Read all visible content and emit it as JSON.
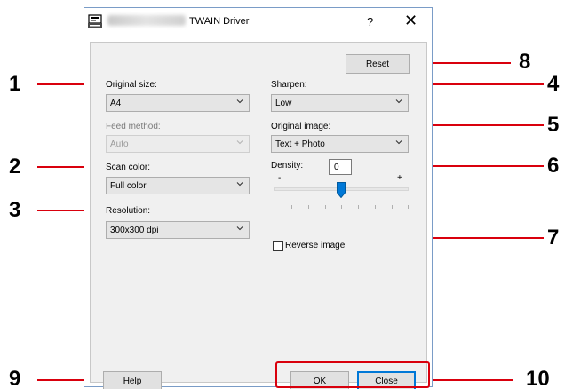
{
  "window": {
    "title": "TWAIN Driver",
    "help_glyph": "?",
    "close_glyph": "✕"
  },
  "left": {
    "original_size_label": "Original size:",
    "original_size_value": "A4",
    "feed_method_label": "Feed method:",
    "feed_method_value": "Auto",
    "scan_color_label": "Scan color:",
    "scan_color_value": "Full color",
    "resolution_label": "Resolution:",
    "resolution_value": "300x300 dpi"
  },
  "right": {
    "reset_label": "Reset",
    "sharpen_label": "Sharpen:",
    "sharpen_value": "Low",
    "original_image_label": "Original image:",
    "original_image_value": "Text + Photo",
    "density_label": "Density:",
    "density_value": "0",
    "density_minus": "-",
    "density_plus": "+",
    "density_level_fraction": 0.5,
    "reverse_image_label": "Reverse image",
    "reverse_image_checked": false
  },
  "footer": {
    "help_label": "Help",
    "ok_label": "OK",
    "close_label": "Close"
  },
  "callouts": {
    "c1": "1",
    "c2": "2",
    "c3": "3",
    "c4": "4",
    "c5": "5",
    "c6": "6",
    "c7": "7",
    "c8": "8",
    "c9": "9",
    "c10": "10"
  },
  "icons": {
    "app": "scanner-app-icon",
    "dropdown": "chevron-down-icon"
  },
  "colors": {
    "callout_red": "#d9000d",
    "default_button_accent": "#0078d7"
  }
}
